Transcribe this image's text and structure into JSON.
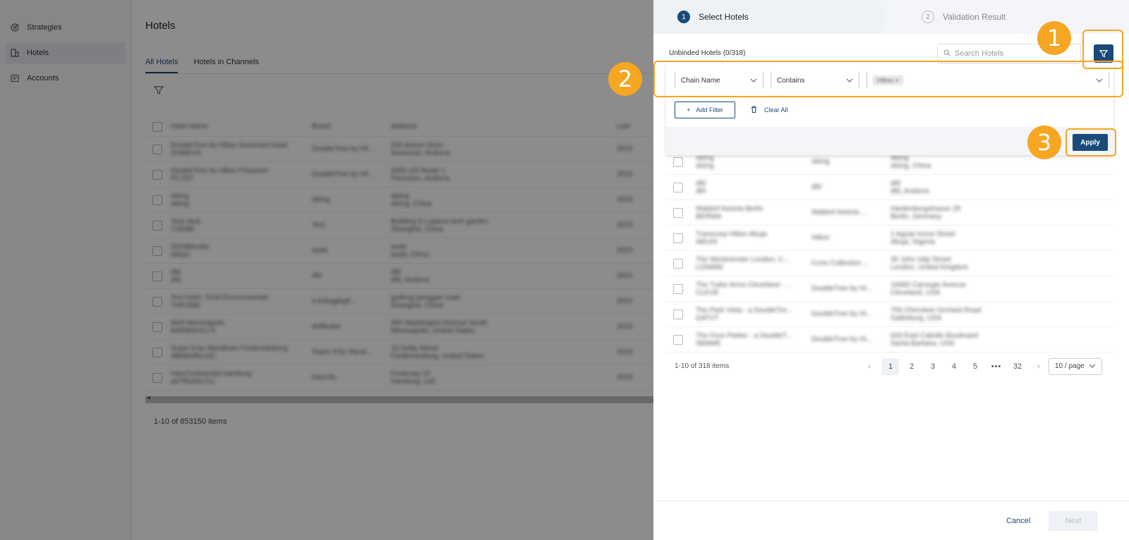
{
  "sidebar": {
    "items": [
      {
        "label": "Strategies",
        "icon": "strategy-icon"
      },
      {
        "label": "Hotels",
        "icon": "building-icon",
        "active": true
      },
      {
        "label": "Accounts",
        "icon": "accounts-icon"
      }
    ]
  },
  "main": {
    "title": "Hotels",
    "tabs": [
      {
        "label": "All Hotels",
        "active": true
      },
      {
        "label": "Hotels in Channels"
      }
    ],
    "table": {
      "headers": [
        "Hotel Name",
        "Brand",
        "Address",
        "Last"
      ],
      "rows": [
        {
          "name": "DoubleTree by Hilton Somerset Hotel",
          "code": "SOMEHX",
          "brand": "DoubleTree by Hil...",
          "address": "200 Atrium Drive",
          "city": "Somerset, Andorra"
        },
        {
          "name": "DoubleTree by Hilton Princeton",
          "code": "PCTDT",
          "brand": "DoubleTree by Hil...",
          "address": "4355 US Route 1",
          "city": "Princeton, Andorra"
        },
        {
          "name": "skiing",
          "code": "skiing",
          "brand": "skiing",
          "address": "skiing",
          "city": "skiing, China"
        },
        {
          "name": "Test-Jack",
          "code": "TJ0085",
          "brand": "Test",
          "address": "Building D Lujiazui tech garden",
          "city": "Shanghai, China"
        },
        {
          "name": "SDSBlender",
          "code": "ddsjst",
          "brand": "asdd",
          "address": "asdd",
          "city": "asdd, China"
        },
        {
          "name": "dfd",
          "code": "dfd",
          "brand": "dfd",
          "address": "dfd",
          "city": "dfd, Andorra"
        },
        {
          "name": "Test hotel, 2018 Environmental",
          "code": "TH01588",
          "brand": "a ksfogghgfl...",
          "address": "guifeng penggan road",
          "city": "Shanghai, China"
        },
        {
          "name": "Aloft Minneapolis",
          "code": "8d0f3b0c0174",
          "brand": "dotfloater",
          "address": "900 Washington Avenue South",
          "city": "Minneapolis, United States"
        },
        {
          "name": "Super 8 by Wyndham Fredericksburg",
          "code": "48b9e0f5c1d1",
          "brand": "Super 8 by Wynd...",
          "address": "10 Delta Street",
          "city": "Fredericksburg, United States"
        },
        {
          "name": "InterContinental Hamburg",
          "code": "a47f5c00c71c",
          "brand": "intercity",
          "address": "Fontenay 10",
          "city": "Hamburg, null"
        }
      ],
      "last_col": "2023"
    },
    "count": "1-10 of 853150 items"
  },
  "drawer": {
    "steps": [
      {
        "num": "1",
        "label": "Select Hotels"
      },
      {
        "num": "2",
        "label": "Validation Result"
      }
    ],
    "unbinded_label": "Unbinded Hotels (0/318)",
    "search_placeholder": "Search Hotels",
    "filter": {
      "field": "Chain Name",
      "operator": "Contains",
      "value_tag": "Hilton",
      "add_filter": "Add Filter",
      "clear_all": "Clear All",
      "apply": "Apply"
    },
    "rows": [
      {
        "name": "skiing",
        "code": "skiing",
        "brand": "skiing",
        "address": "skiing",
        "city": "skiing, China"
      },
      {
        "name": "dfd",
        "code": "dfd",
        "brand": "dfd",
        "address": "dfd",
        "city": "dfd, Andorra"
      },
      {
        "name": "Waldorf Astoria Berlin",
        "code": "BERWA",
        "brand": "Waldorf Astoria ...",
        "address": "Hardenbergstrasse 28",
        "city": "Berlin, Germany"
      },
      {
        "name": "Transcorp Hilton Abuja",
        "code": "ABUHI",
        "brand": "Hilton",
        "address": "1 Aguiyi Ironsi Street",
        "city": "Abuja, Nigeria"
      },
      {
        "name": "The Westminster London, C...",
        "code": "LONWM",
        "brand": "Curio Collection ...",
        "address": "30 John Islip Street",
        "city": "London, United Kingdom"
      },
      {
        "name": "The Tudor Arms Cleveland - ...",
        "code": "CLEVE",
        "brand": "DoubleTree by Hi...",
        "address": "10660 Carnegie Avenue",
        "city": "Cleveland, USA"
      },
      {
        "name": "The Park Vista - a DoubleTre...",
        "code": "GATVT",
        "brand": "DoubleTree by Hi...",
        "address": "705 Cherokee Orchard Road",
        "city": "Gatlinburg, USA"
      },
      {
        "name": "The Fess Parker - a DoubleT...",
        "code": "SBAWE",
        "brand": "DoubleTree by Hi...",
        "address": "633 East Cabrillo Boulevard",
        "city": "Santa Barbara, USA"
      }
    ],
    "pagination": {
      "count": "1-10 of 318 items",
      "pages": [
        "1",
        "2",
        "3",
        "4",
        "5",
        "•••",
        "32"
      ],
      "page_size": "10 / page"
    },
    "cancel": "Cancel",
    "next": "Next"
  },
  "callouts": [
    "1",
    "2",
    "3"
  ],
  "colors": {
    "accent": "#1a4a7a",
    "callout": "#f5a623"
  }
}
